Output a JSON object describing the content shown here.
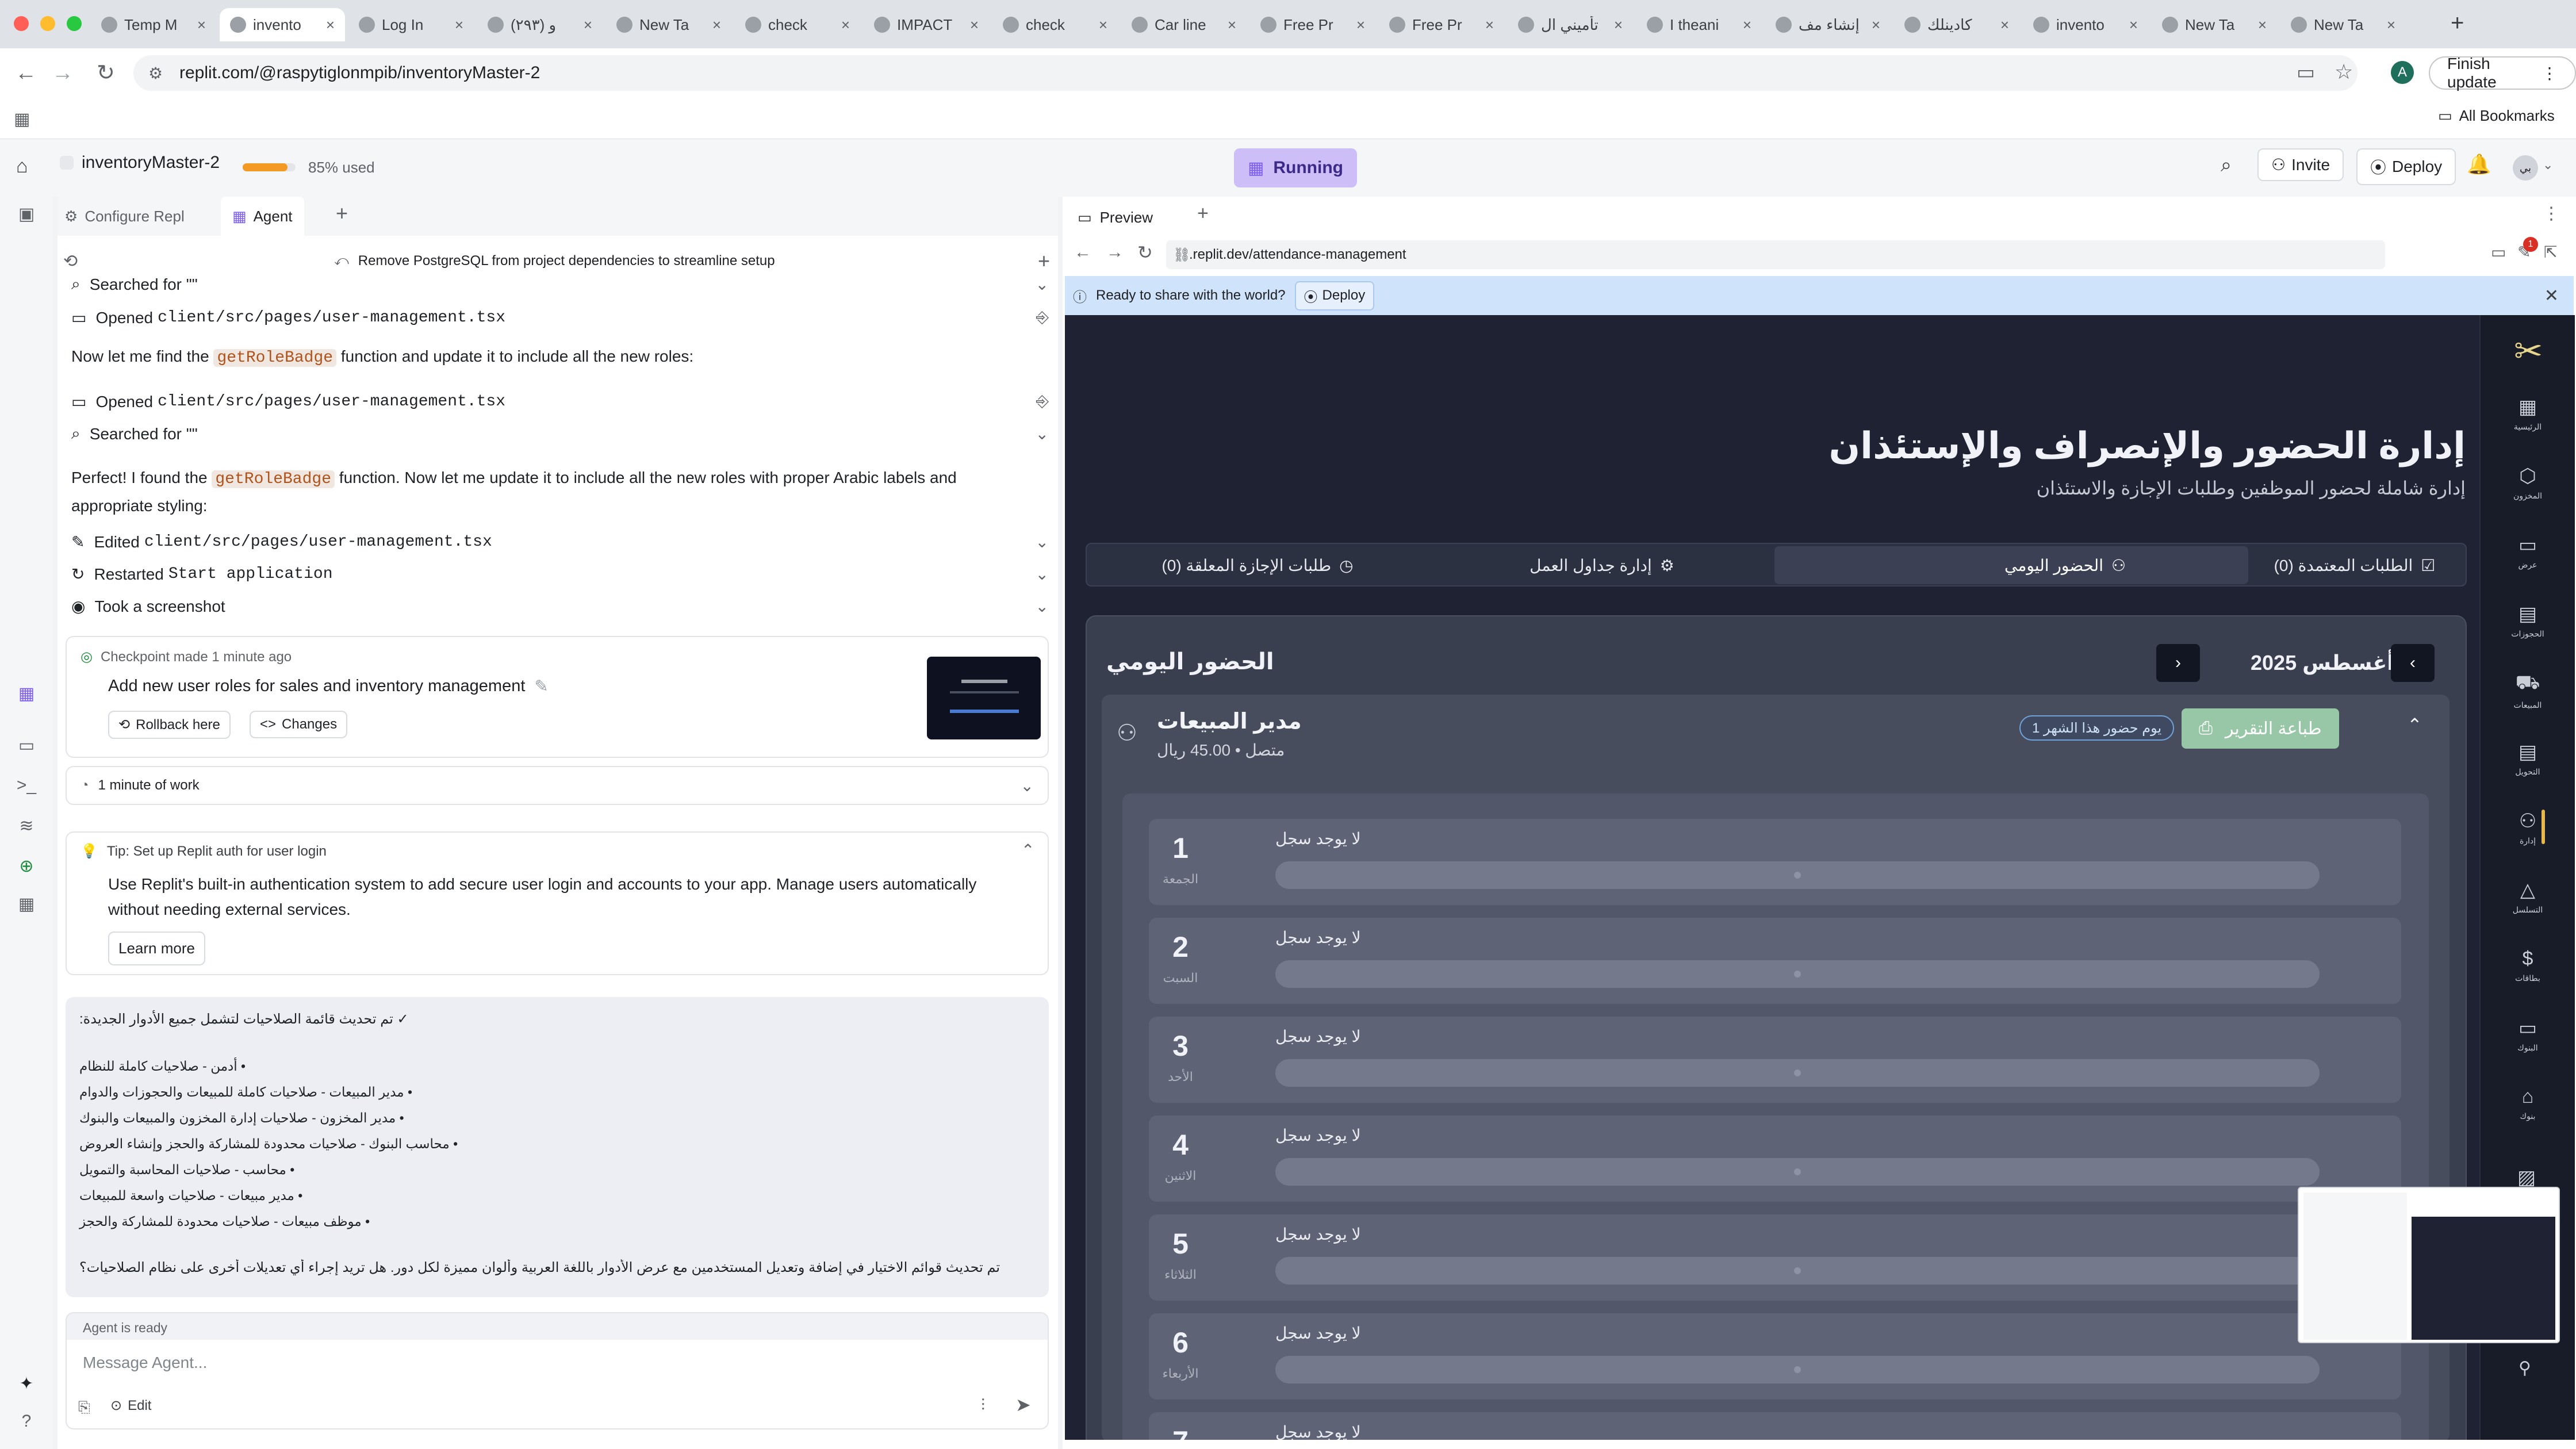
{
  "browser": {
    "tabs": [
      {
        "title": "Temp M",
        "icon": "shield-icon"
      },
      {
        "title": "invento",
        "icon": "replit-icon",
        "active": true
      },
      {
        "title": "Log In",
        "icon": "replit-icon"
      },
      {
        "title": "(٢٩٣) و",
        "icon": "whatsapp-icon"
      },
      {
        "title": "New Ta",
        "icon": "chrome-icon"
      },
      {
        "title": "check",
        "icon": "google-icon"
      },
      {
        "title": "IMPACT",
        "icon": "impact-icon"
      },
      {
        "title": "check",
        "icon": "google-icon"
      },
      {
        "title": "Car line",
        "icon": "car-icon"
      },
      {
        "title": "Free Pr",
        "icon": "pinterest-icon"
      },
      {
        "title": "Free Pr",
        "icon": "chrome-icon"
      },
      {
        "title": "تأميني ال",
        "icon": "insurance-icon"
      },
      {
        "title": "I theani",
        "icon": "google-icon"
      },
      {
        "title": "إنشاء مف",
        "icon": "openai-icon"
      },
      {
        "title": "كادينلك",
        "icon": "google-icon"
      },
      {
        "title": "invento",
        "icon": "chrome-icon"
      },
      {
        "title": "New Ta",
        "icon": "chrome-icon"
      },
      {
        "title": "New Ta",
        "icon": "chrome-icon"
      }
    ],
    "url": "replit.com/@raspytiglonmpib/inventoryMaster-2",
    "profile_initial": "A",
    "finish_update": "Finish update",
    "all_bookmarks": "All Bookmarks"
  },
  "replit": {
    "project_name": "inventoryMaster-2",
    "usage_label": "85% used",
    "usage_fraction": 0.85,
    "running_label": "Running",
    "invite_label": "Invite",
    "deploy_label": "Deploy",
    "avatar_label": "بي",
    "tabs": {
      "configure": "Configure Repl",
      "agent": "Agent",
      "preview": "Preview"
    }
  },
  "agent": {
    "history_title": "Remove PostgreSQL from project dependencies to streamline setup",
    "searched_1": "Searched for \"\"",
    "opened_1_prefix": "Opened",
    "opened_1_file": "client/src/pages/user-management.tsx",
    "msg_1_before": "Now let me find the",
    "msg_1_code": "getRoleBadge",
    "msg_1_after": "function and update it to include all the new roles:",
    "opened_2_prefix": "Opened",
    "opened_2_file": "client/src/pages/user-management.tsx",
    "searched_2": "Searched for \"\"",
    "msg_2_before": "Perfect! I found the",
    "msg_2_code": "getRoleBadge",
    "msg_2_after": "function. Now let me update it to include all the new roles with proper Arabic labels and",
    "msg_2_line2": "appropriate styling:",
    "edited_prefix": "Edited",
    "edited_file": "client/src/pages/user-management.tsx",
    "restarted_prefix": "Restarted",
    "restarted_name": "Start application",
    "screenshot": "Took a screenshot",
    "checkpoint": {
      "header": "Checkpoint made 1 minute ago",
      "title": "Add new user roles for sales and inventory management",
      "rollback": "Rollback here",
      "changes": "Changes"
    },
    "work_label": "1 minute of work",
    "tip": {
      "title": "Tip: Set up Replit auth for user login",
      "body_1": "Use Replit's built-in authentication system to add secure user login and accounts to your app. Manage users automatically",
      "body_2": "without needing external services.",
      "learn_more": "Learn more"
    },
    "response": {
      "heading": "✓ تم تحديث قائمة الصلاحيات لتشمل جميع الأدوار الجديدة:",
      "items": [
        "• أدمن - صلاحيات كاملة للنظام",
        "• مدير المبيعات - صلاحيات كاملة للمبيعات والحجوزات والدوام",
        "• مدير المخزون - صلاحيات إدارة المخزون والمبيعات والبنوك",
        "• محاسب البنوك - صلاحيات محدودة للمشاركة والحجز وإنشاء العروض",
        "• محاسب - صلاحيات المحاسبة والتمويل",
        "• مدير مبيعات - صلاحيات واسعة للمبيعات",
        "• موظف مبيعات - صلاحيات محدودة للمشاركة والحجز"
      ],
      "footer": "تم تحديث قوائم الاختيار في إضافة وتعديل المستخدمين مع عرض الأدوار باللغة العربية وألوان مميزة لكل دور. هل تريد إجراء أي تعديلات أخرى على نظام الصلاحيات؟"
    },
    "status": "Agent is ready",
    "input_placeholder": "Message Agent...",
    "edit_label": "Edit"
  },
  "preview": {
    "url": ".replit.dev/attendance-management",
    "banner_text": "Ready to share with the world?",
    "banner_button": "Deploy",
    "notif_count": "1",
    "page": {
      "title": "إدارة الحضور والإنصراف والإستئذان",
      "subtitle": "إدارة شاملة لحضور الموظفين وطلبات الإجازة والاستئذان",
      "tabs": [
        "الطلبات المعتمدة (0)",
        "الحضور اليومي",
        "إدارة جداول العمل",
        "طلبات الإجازة المعلقة (0)"
      ],
      "section_title": "الحضور اليومي",
      "month_label": "أغسطس 2025",
      "employee_name": "مدير المبيعات",
      "employee_meta": "متصل • 45.00 ريال",
      "print_label": "طباعة التقرير",
      "badge_label": "1 يوم حضور هذا الشهر",
      "days": [
        {
          "num": "1",
          "name": "الجمعة",
          "status": "لا يوجد سجل"
        },
        {
          "num": "2",
          "name": "السبت",
          "status": "لا يوجد سجل"
        },
        {
          "num": "3",
          "name": "الأحد",
          "status": "لا يوجد سجل"
        },
        {
          "num": "4",
          "name": "الاثنين",
          "status": "لا يوجد سجل"
        },
        {
          "num": "5",
          "name": "الثلاثاء",
          "status": "لا يوجد سجل"
        },
        {
          "num": "6",
          "name": "الأربعاء",
          "status": "لا يوجد سجل"
        },
        {
          "num": "7",
          "name": "",
          "status": "لا يوجد سجل"
        }
      ],
      "sidebar": [
        "الرئيسية",
        "المخزون",
        "عرض",
        "الحجوزات",
        "المبيعات",
        "التحويل",
        "إدارة",
        "التسلسل",
        "بطاقات",
        "البنوك",
        "بنوك"
      ]
    }
  },
  "colors": {
    "accent_purple": "#7b5cf5",
    "running_bg": "#cdbef8",
    "app_bg": "#1e2233",
    "banner_bg": "#cfe3fb",
    "print_green": "#97c7a6"
  }
}
